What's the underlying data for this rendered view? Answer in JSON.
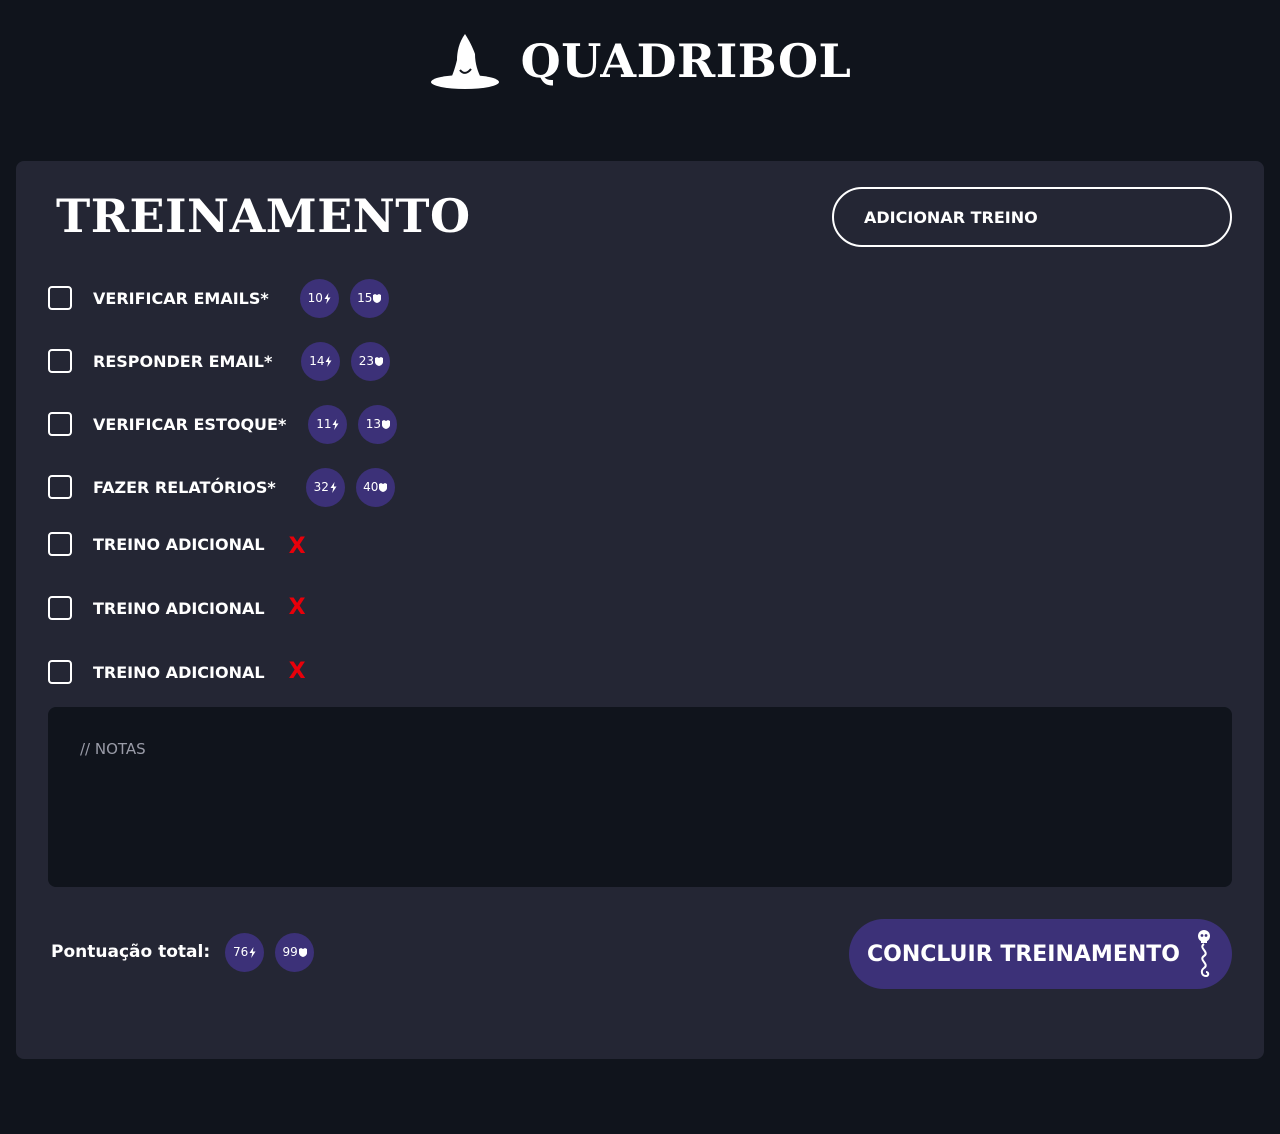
{
  "header": {
    "brand": "QUADRIBOL",
    "logo_icon": "witch-hat-icon"
  },
  "main": {
    "title": "TREINAMENTO",
    "add_button_label": "ADICIONAR TREINO",
    "tasks": [
      {
        "label": "VERIFICAR EMAILS*",
        "energy": "10",
        "house": "15"
      },
      {
        "label": "RESPONDER EMAIL*",
        "energy": "14",
        "house": "23"
      },
      {
        "label": "VERIFICAR ESTOQUE*",
        "energy": "11",
        "house": "13"
      },
      {
        "label": "FAZER RELATÓRIOS*",
        "energy": "32",
        "house": "40"
      }
    ],
    "extra_tasks": [
      {
        "label": "TREINO ADICIONAL",
        "remove": "X"
      },
      {
        "label": "TREINO ADICIONAL",
        "remove": "X"
      },
      {
        "label": "TREINO ADICIONAL",
        "remove": "X"
      }
    ],
    "notes_placeholder": "// NOTAS",
    "total_label": "Pontuação total:",
    "total_energy": "76",
    "total_house": "99",
    "finish_button_label": "CONCLUIR TREINAMENTO",
    "finish_icon": "dark-mark-skull-snake-icon",
    "badge_icons": [
      "lightning-bolt-icon",
      "house-crest-icon"
    ]
  },
  "colors": {
    "page_background": "#10141c",
    "card_background": "#242634",
    "accent_purple": "#3c3178",
    "remove_red": "#e8000a",
    "text": "#ffffff"
  }
}
